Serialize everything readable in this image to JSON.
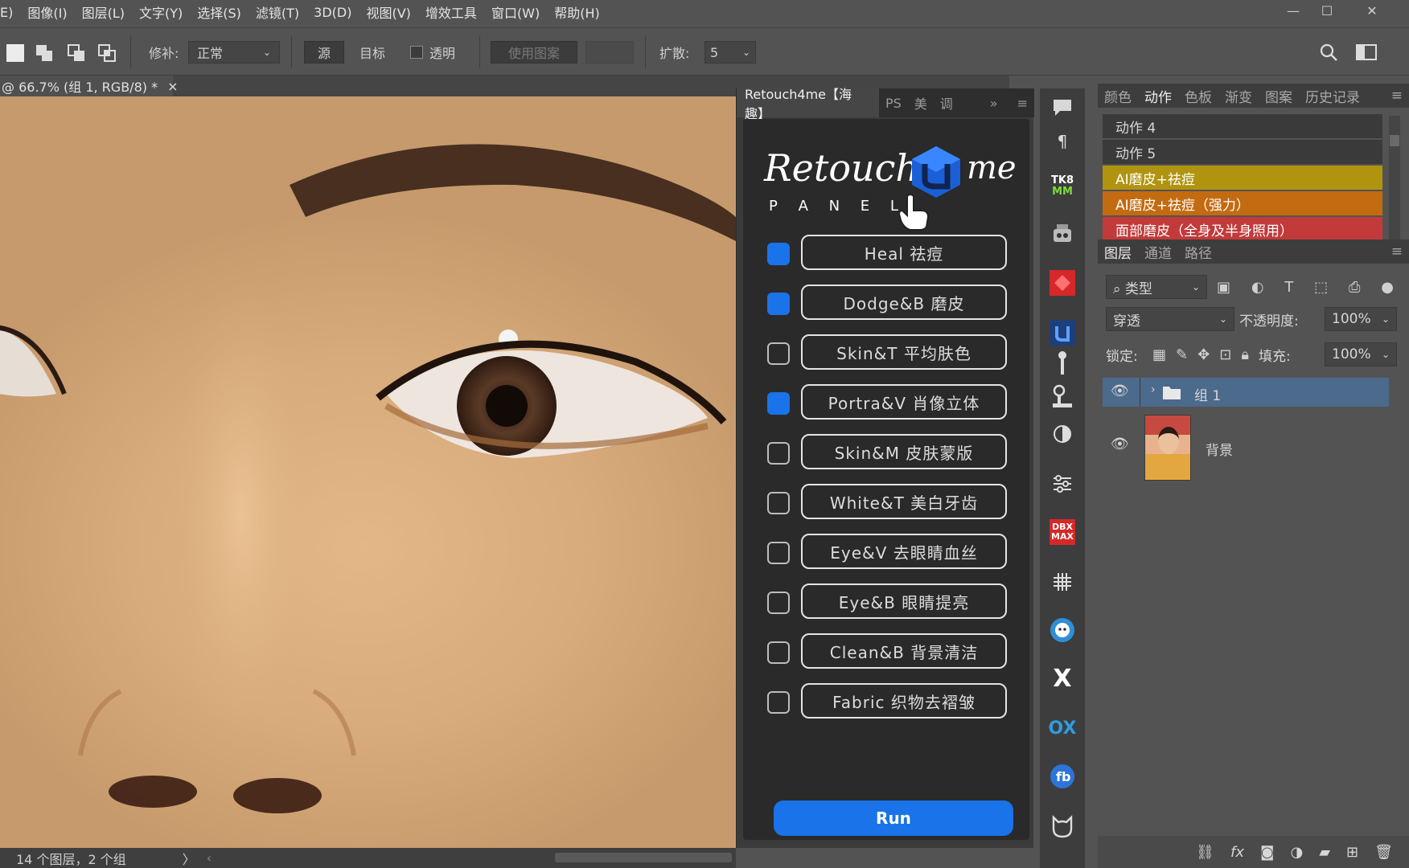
{
  "menu": {
    "items": [
      "E)",
      "图像(I)",
      "图层(L)",
      "文字(Y)",
      "选择(S)",
      "滤镜(T)",
      "3D(D)",
      "视图(V)",
      "增效工具",
      "窗口(W)",
      "帮助(H)"
    ],
    "window_controls": {
      "minimize": "—",
      "maximize": "☐",
      "close": "✕"
    }
  },
  "options_bar": {
    "patch_label": "修补:",
    "patch_mode": "正常",
    "source_label": "源",
    "target_label": "目标",
    "transparent_label": "透明",
    "use_pattern_label": "使用图案",
    "diffusion_label": "扩散:",
    "diffusion_value": "5"
  },
  "document": {
    "tab_title": "@ 66.7% (组 1, RGB/8) *",
    "close_glyph": "×"
  },
  "status_bar": {
    "text": "14 个图层，2 个组",
    "arrow": "〉"
  },
  "retouch_panel": {
    "tabs": [
      "Retouch4me【海趣】",
      "PS",
      "美",
      "调"
    ],
    "more_glyph": "»",
    "logo_text": "Retouch",
    "logo_suffix": "me",
    "logo_sub": "P A N E L",
    "options": [
      {
        "label": "Heal 祛痘",
        "checked": true
      },
      {
        "label": "Dodge&B 磨皮",
        "checked": true
      },
      {
        "label": "Skin&T 平均肤色",
        "checked": false
      },
      {
        "label": "Portra&V 肖像立体",
        "checked": true
      },
      {
        "label": "Skin&M 皮肤蒙版",
        "checked": false
      },
      {
        "label": "White&T 美白牙齿",
        "checked": false
      },
      {
        "label": "Eye&V 去眼睛血丝",
        "checked": false
      },
      {
        "label": "Eye&B 眼睛提亮",
        "checked": false
      },
      {
        "label": "Clean&B 背景清洁",
        "checked": false
      },
      {
        "label": "Fabric 织物去褶皱",
        "checked": false
      }
    ],
    "run_label": "Run",
    "accent": "#1a73e8"
  },
  "tool_strip": {
    "icons": [
      "comment-icon",
      "paragraph-icon",
      "tkmm-plugin-icon",
      "robot-plugin-icon",
      "red-plugin-icon",
      "retouch4me-icon",
      "brush-stand-icon",
      "clone-stamp-icon",
      "contrast-icon",
      "adjust-sliders-icon",
      "dbx-max-icon",
      "grid-icon",
      "face-plugin-icon",
      "x-plugin-icon",
      "ox-plugin-icon",
      "fb-plugin-icon",
      "cat-plugin-icon"
    ],
    "labels": {
      "tkmm": "TK8 MM",
      "dbx": "DBX MAX",
      "ox": "OX"
    }
  },
  "actions_panel": {
    "tabs": [
      "颜色",
      "动作",
      "色板",
      "渐变",
      "图案",
      "历史记录"
    ],
    "active_tab": "动作",
    "items": [
      {
        "label": "动作 4",
        "color": "#3a3a3a"
      },
      {
        "label": "动作 5",
        "color": "#3a3a3a"
      },
      {
        "label": "AI磨皮+祛痘",
        "color": "#b0940f"
      },
      {
        "label": "AI磨皮+祛痘（强力）",
        "color": "#c36b10"
      },
      {
        "label": "面部磨皮（全身及半身照用）",
        "color": "#c23a3a"
      }
    ]
  },
  "layers_panel": {
    "tabs": [
      "图层",
      "通道",
      "路径"
    ],
    "active_tab": "图层",
    "filter_label": "类型",
    "blend_mode": "穿透",
    "opacity_label": "不透明度:",
    "opacity_value": "100%",
    "lock_label": "锁定:",
    "fill_label": "填充:",
    "fill_value": "100%",
    "layers": [
      {
        "name": "组 1",
        "type": "group",
        "selected": true
      },
      {
        "name": "背景",
        "type": "image",
        "selected": false
      }
    ],
    "footer_icons": [
      "link-icon",
      "fx-icon",
      "mask-icon",
      "adjustment-icon",
      "folder-icon",
      "new-layer-icon",
      "trash-icon"
    ],
    "fx_label": "fx"
  }
}
